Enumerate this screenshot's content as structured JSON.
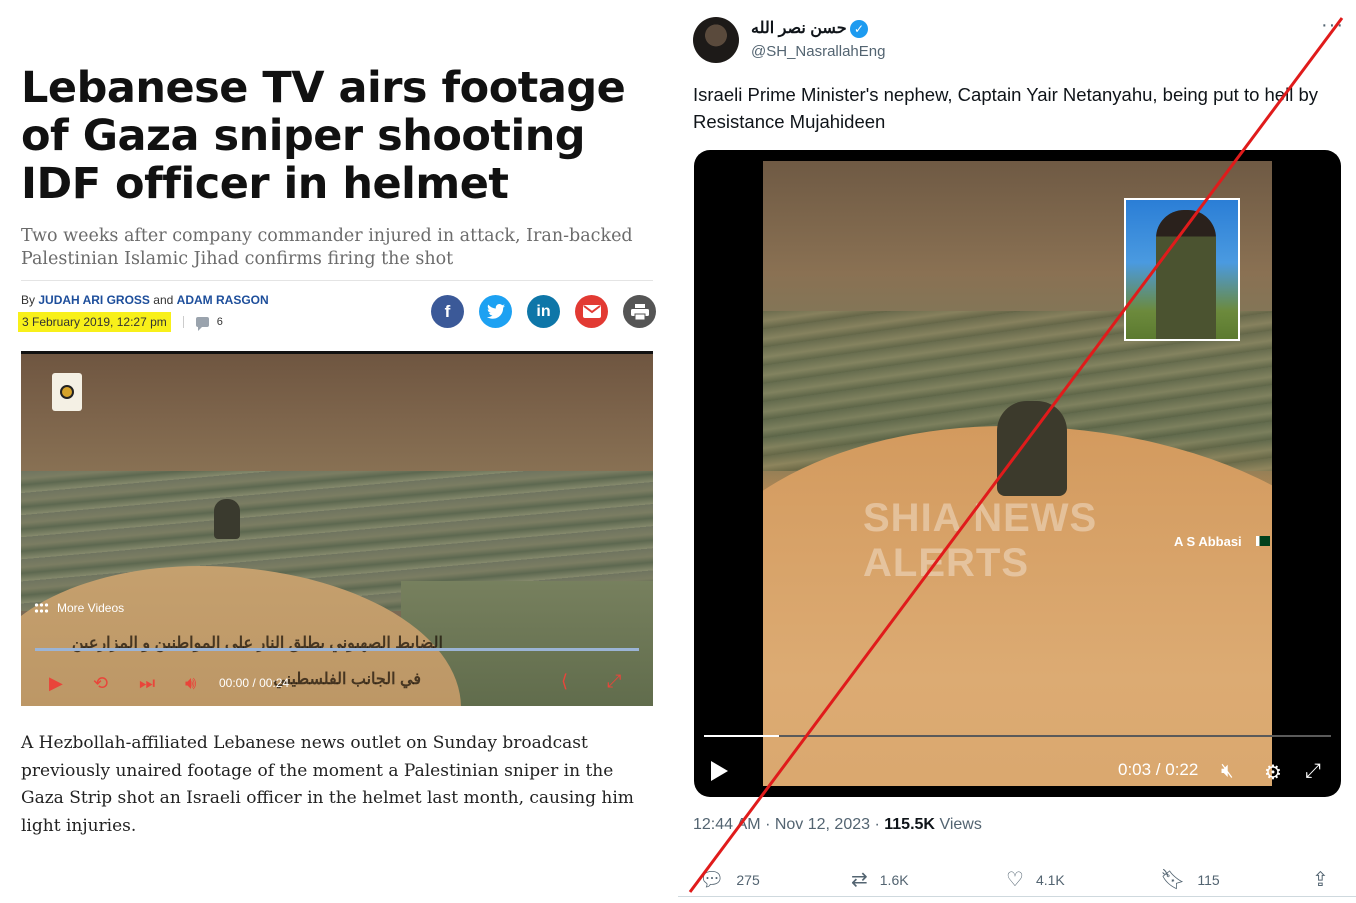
{
  "article": {
    "headline": "Lebanese TV airs footage of Gaza sniper shooting IDF officer in helmet",
    "subhead": "Two weeks after company commander injured in attack, Iran-backed Palestinian Islamic Jihad confirms firing the shot",
    "byline_prefix": "By",
    "author1": "JUDAH ARI GROSS",
    "byline_and": "and",
    "author2": "ADAM RASGON",
    "date": "3 February 2019, 12:27 pm",
    "comment_count": "6",
    "share_icons": [
      "facebook-icon",
      "twitter-icon",
      "linkedin-icon",
      "email-icon",
      "print-icon"
    ],
    "share_colors": [
      "#3b5998",
      "#1da1f2",
      "#0e76a8",
      "#e23a33",
      "#555555"
    ],
    "video": {
      "more_videos": "More Videos",
      "caption_line1": "الضابط الصهيوني بطلق النار على المواطنين و المزارعين",
      "caption_line2": "في الجانب الفلسطيني",
      "time_current": "00:00",
      "time_sep": "/",
      "time_total": "00:24"
    },
    "body": "A Hezbollah-affiliated Lebanese news outlet on Sunday broadcast previously unaired footage of the moment a Palestinian sniper in the Gaza Strip shot an Israeli officer in the helmet last month, causing him light injuries."
  },
  "tweet": {
    "display_name": "حسن نصر الله",
    "handle": "@SH_NasrallahEng",
    "text": "Israeli Prime Minister's nephew, Captain Yair Netanyahu, being put to hell by Resistance Mujahideen",
    "video": {
      "watermark": "SHIA NEWS ALERTS",
      "overlay_name": "A S Abbasi",
      "time": "0:03 / 0:22",
      "progress": 0.12
    },
    "time": "12:44 AM",
    "dot": "·",
    "date": "Nov 12, 2023",
    "dot2": "·",
    "views_count": "115.5K",
    "views_label": "Views",
    "replies": "275",
    "reposts": "1.6K",
    "likes": "4.1K",
    "bookmarks": "115",
    "accent_color": "#1d9bf0"
  },
  "crossout_color": "#e01b1b"
}
